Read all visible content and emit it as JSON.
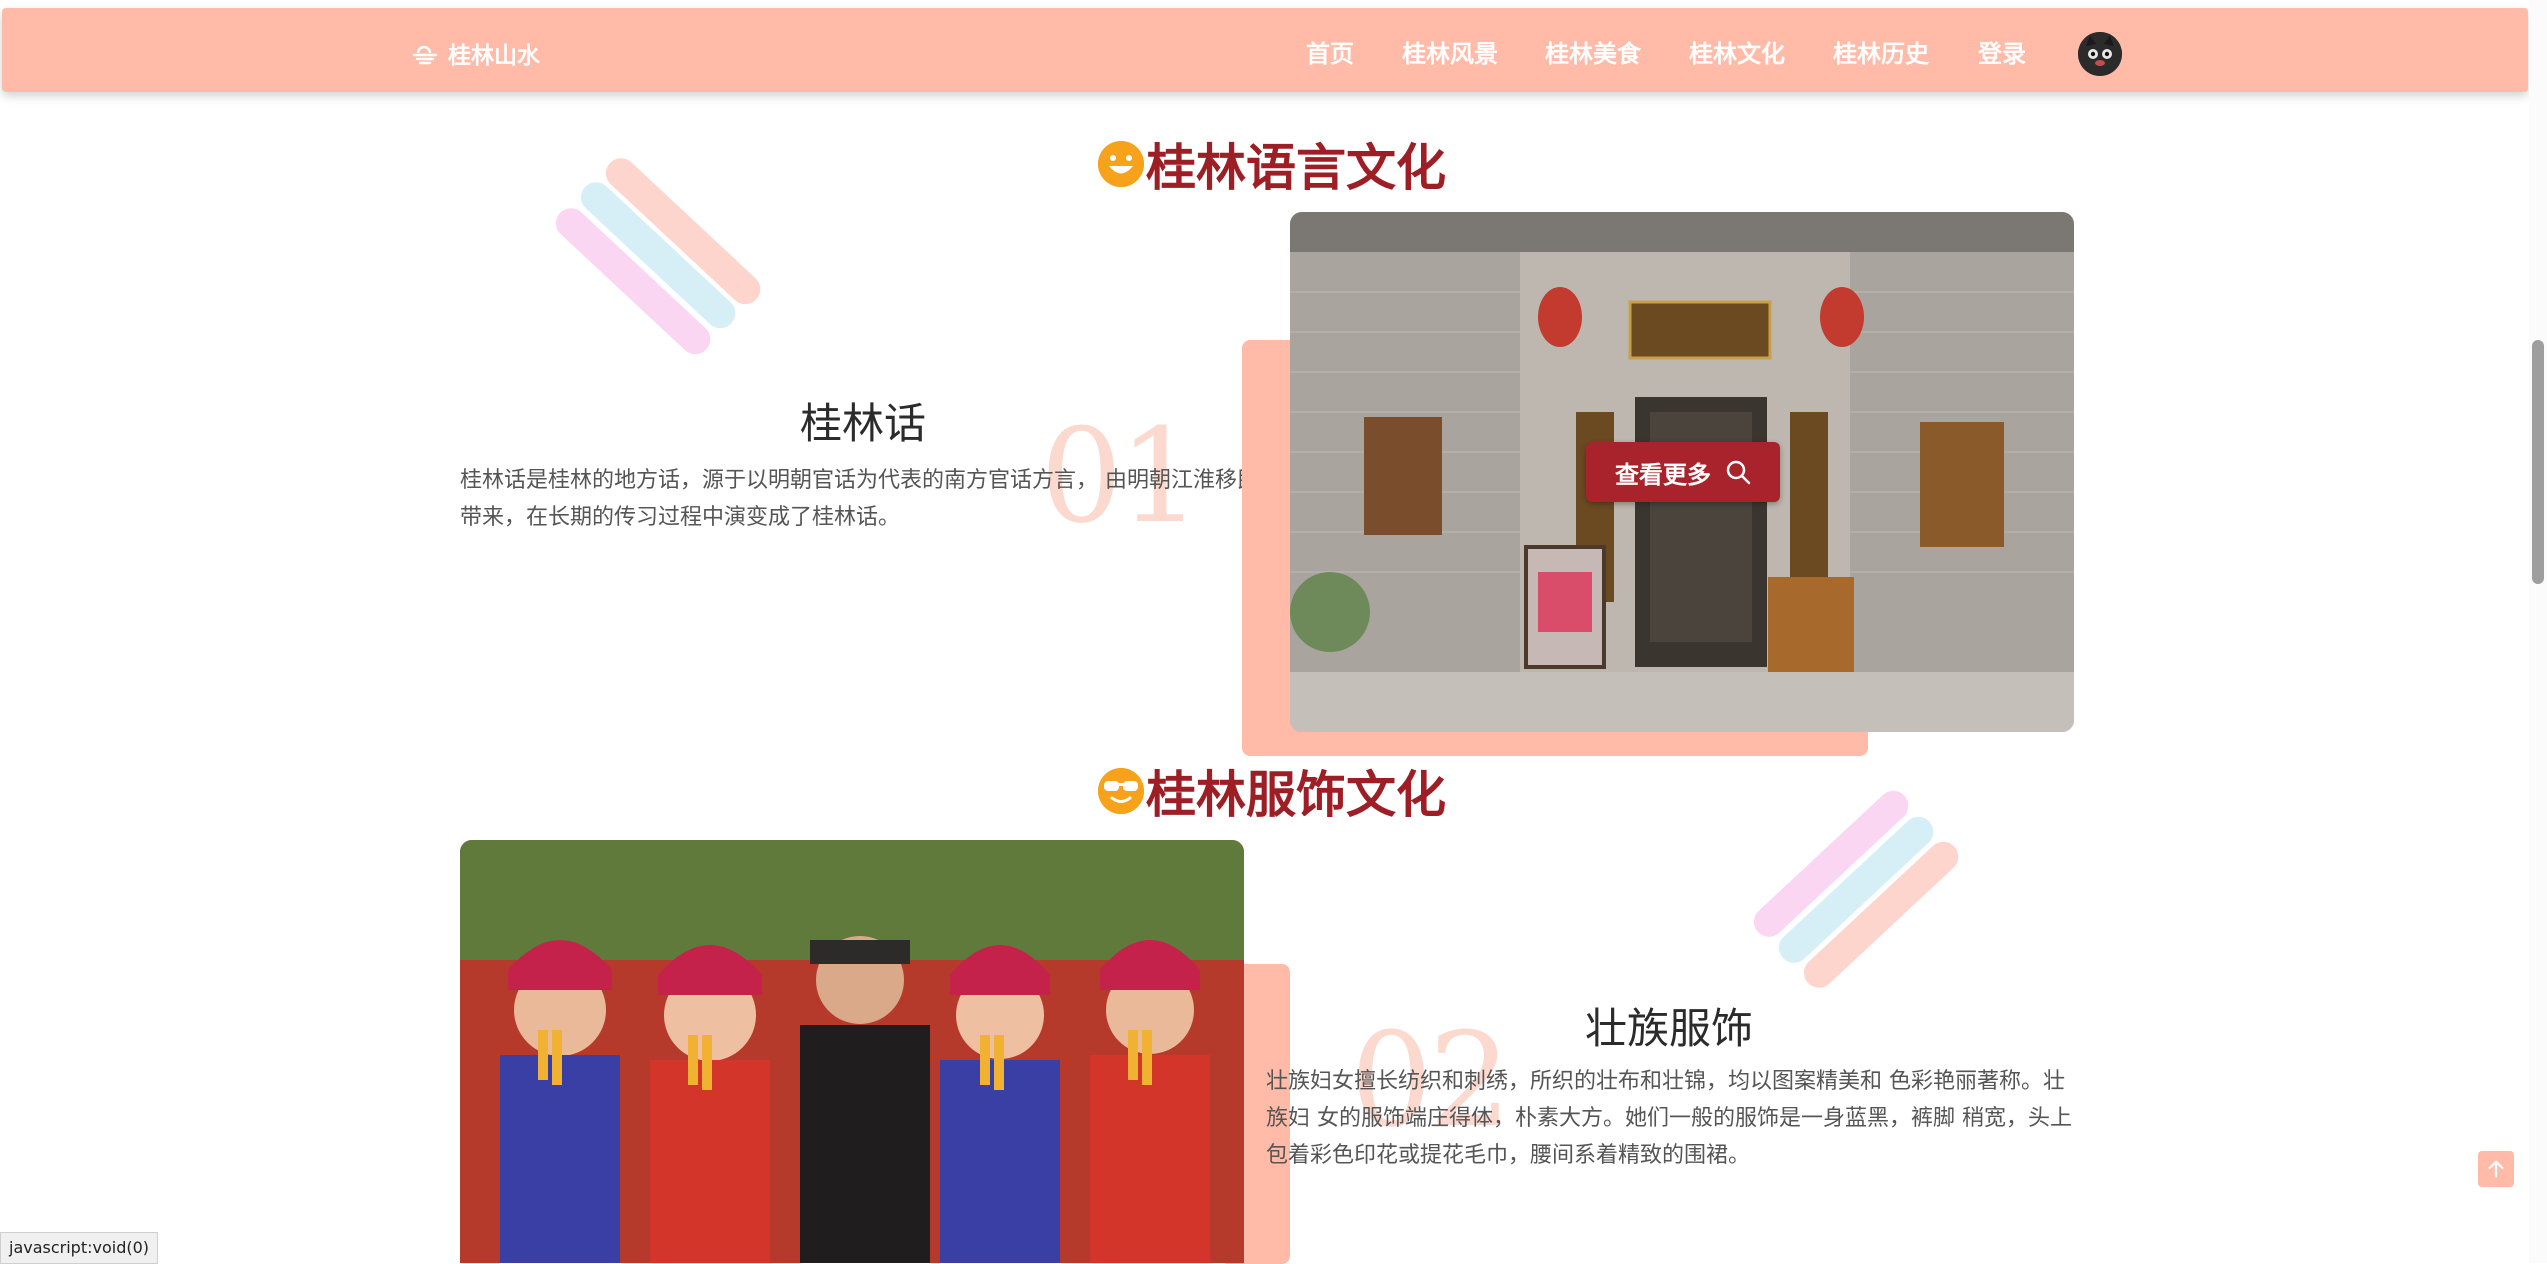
{
  "header": {
    "logo_text": "桂林山水",
    "nav": [
      "首页",
      "桂林风景",
      "桂林美食",
      "桂林文化",
      "桂林历史",
      "登录"
    ],
    "bg_color": "#ffbaa8"
  },
  "sections": {
    "language": {
      "title": "桂林语言文化",
      "item_heading": "桂林话",
      "item_number": "01",
      "item_text": "桂林话是桂林的地方话，源于以明朝官话为代表的南方官话方言， 由明朝江淮移民带来，在长期的传习过程中演变成了桂林话。",
      "button_label": "查看更多"
    },
    "clothing": {
      "title": "桂林服饰文化",
      "item_heading": "壮族服饰",
      "item_number": "02",
      "item_text": "壮族妇女擅长纺织和刺绣，所织的壮布和壮锦，均以图案精美和 色彩艳丽著称。壮族妇 女的服饰端庄得体，朴素大方。她们一般的服饰是一身蓝黑，裤脚 稍宽，头上包着彩色印花或提花毛巾，腰间系着精致的围裙。"
    }
  },
  "status_bar": {
    "text": "javascript:void(0)"
  },
  "icons": {
    "logo": "cloud-sun-icon",
    "search": "search-icon",
    "back_to_top": "arrow-up-icon",
    "title1_emoji": "smiling-face-icon",
    "title2_emoji": "sunglasses-face-icon"
  },
  "colors": {
    "accent": "#9e1e26",
    "salmon": "#ffbaa8",
    "number": "#fcd9cf"
  }
}
